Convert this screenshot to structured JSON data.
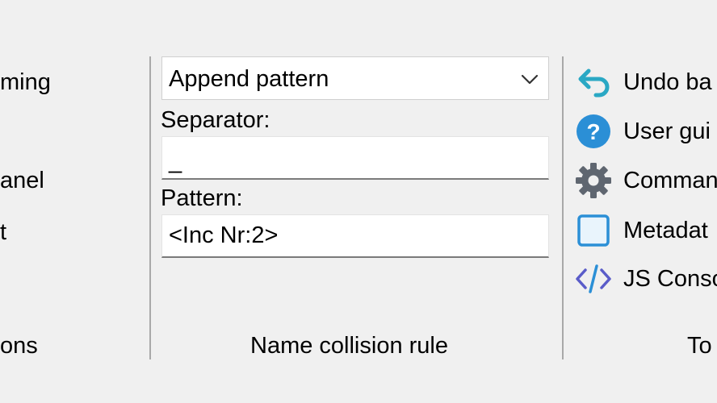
{
  "left_group": {
    "items": [
      "ming",
      "anel",
      "t"
    ],
    "footer": "ons"
  },
  "collision_group": {
    "mode_select": {
      "selected": "Append pattern"
    },
    "separator": {
      "label": "Separator:",
      "value": "_"
    },
    "pattern": {
      "label": "Pattern:",
      "value": "<Inc Nr:2>"
    },
    "footer": "Name collision rule"
  },
  "tools_group": {
    "items": [
      {
        "label": "Undo ba",
        "icon": "undo-arrow-icon"
      },
      {
        "label": "User gui",
        "icon": "help-icon"
      },
      {
        "label": "Comman",
        "icon": "gear-icon"
      },
      {
        "label": "Metadat",
        "icon": "checkbox-icon"
      },
      {
        "label": "JS Conso",
        "icon": "code-icon"
      }
    ],
    "footer": "To"
  },
  "colors": {
    "accent_blue": "#2b8fd6",
    "undo_teal": "#2aa8c4",
    "gear_gray": "#5f6670",
    "code_purple": "#5a5cc9",
    "separator_gray": "#a9a9a9"
  }
}
